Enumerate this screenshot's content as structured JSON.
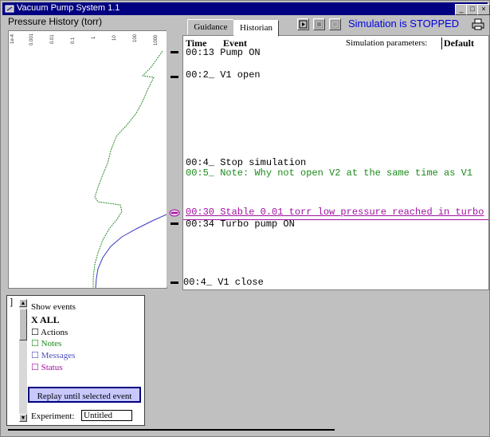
{
  "window": {
    "title": "Vacuum Pump System 1.1"
  },
  "chart": {
    "title": "Pressure History (torr)",
    "tick_labels": [
      "1e-4",
      "0.001",
      "0.01",
      "0.1",
      "1",
      "10",
      "100",
      "1000"
    ]
  },
  "tabs": [
    {
      "label": "Guidance",
      "active": false
    },
    {
      "label": "Historian",
      "active": true
    }
  ],
  "toolbar": {
    "status": "Simulation is STOPPED"
  },
  "historian": {
    "col_time": "Time",
    "col_event": "Event",
    "sim_params_label": "Simulation parameters:",
    "sim_params_value": "Default",
    "events": [
      {
        "text": "00:13 Pump ON",
        "color": "#000000"
      },
      {
        "text": "00:2_ V1 open",
        "color": "#000000"
      },
      {
        "text": "00:4_ Stop simulation",
        "color": "#000000"
      },
      {
        "text": "00:5_ Note: Why not open V2 at the same time as V1",
        "color": "#1a8a1a"
      },
      {
        "text": "00:30 Stable 0.01 torr low pressure reached in turbo",
        "color": "#a010a0"
      },
      {
        "text": "00:34 Turbo pump ON",
        "color": "#000000"
      },
      {
        "text": "00:4_ V1 close",
        "color": "#000000"
      }
    ]
  },
  "filter": {
    "show_events": "Show events",
    "all": "X ALL",
    "actions": "☐ Actions",
    "notes": "☐ Notes",
    "messages": "☐ Messages",
    "status": "☐ Status",
    "colors": {
      "notes": "#1a8a1a",
      "messages": "#5050c0",
      "status": "#a010a0"
    },
    "replay_button": "Replay until selected event",
    "experiment_label": "Experiment:",
    "experiment_value": "Untitled"
  }
}
